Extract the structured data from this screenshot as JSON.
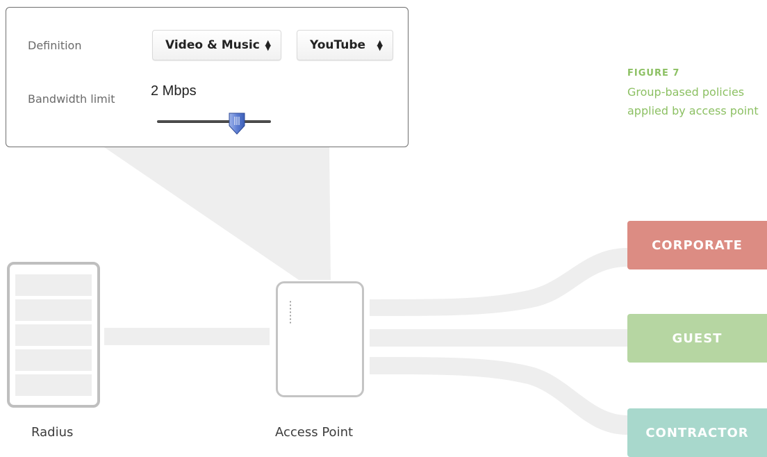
{
  "policy_panel": {
    "definition_label": "Definition",
    "category_select": "Video & Music",
    "app_select": "YouTube",
    "bandwidth_label": "Bandwidth limit",
    "bandwidth_value": "2 Mbps",
    "slider_level": 0.7
  },
  "caption": {
    "figure": "FIGURE 7",
    "text": "Group-based policies applied by access point"
  },
  "nodes": {
    "radius": "Radius",
    "access_point": "Access Point"
  },
  "groups": [
    {
      "label": "CORPORATE",
      "color": "#dc8c83"
    },
    {
      "label": "GUEST",
      "color": "#b6d6a2"
    },
    {
      "label": "CONTRACTOR",
      "color": "#a8d8cc"
    }
  ],
  "colors": {
    "caption": "#8cc063",
    "connector": "#eeeeee",
    "device_border": "#c0c0c0"
  }
}
